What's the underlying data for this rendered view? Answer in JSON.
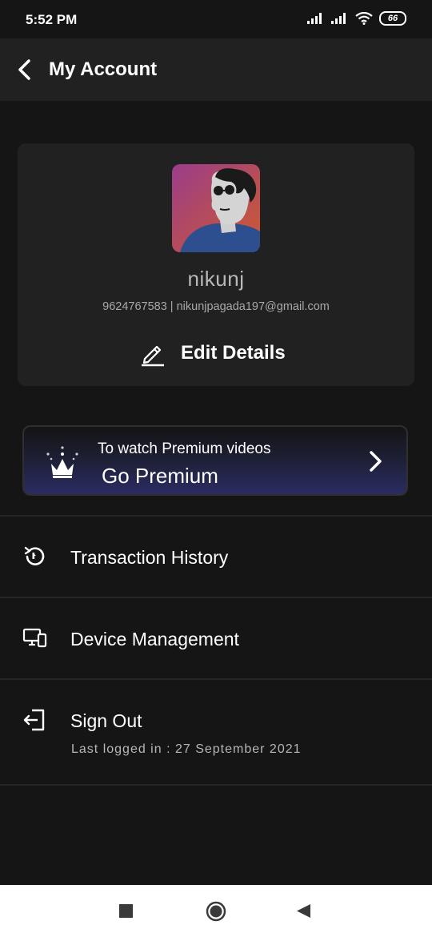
{
  "status_bar": {
    "time": "5:52 PM",
    "battery": "66"
  },
  "app_bar": {
    "title": "My Account"
  },
  "profile": {
    "name": "nikunj",
    "contact": "9624767583 | nikunjpagada197@gmail.com",
    "edit_label": "Edit Details"
  },
  "premium": {
    "subtitle": "To watch Premium videos",
    "title": "Go Premium"
  },
  "menu": {
    "transaction_history": "Transaction History",
    "device_management": "Device Management",
    "sign_out": "Sign Out",
    "last_logged_in": "Last logged in : 27 September 2021"
  },
  "colors": {
    "background": "#151515",
    "card": "#212121",
    "premium_gradient_end": "#2b2c63",
    "text_primary": "#ffffff",
    "text_secondary": "#a8a8a8"
  },
  "icons": {
    "back": "chevron-left-icon",
    "edit": "pencil-icon",
    "premium": "crown-icon",
    "premium_arrow": "chevron-right-icon",
    "transaction_history": "history-icon",
    "device_management": "devices-icon",
    "sign_out": "logout-icon"
  }
}
